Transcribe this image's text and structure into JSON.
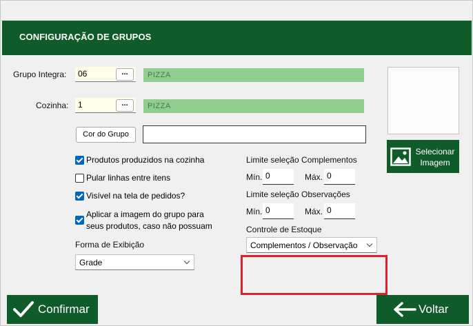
{
  "header": {
    "title": "CONFIGURAÇÃO DE GRUPOS"
  },
  "grupo_integra": {
    "label": "Grupo Integra:",
    "code": "06",
    "lookup_label": "...",
    "name": "PIZZA"
  },
  "cozinha": {
    "label": "Cozinha:",
    "code": "1",
    "lookup_label": "...",
    "name": "PIZZA"
  },
  "cor_do_grupo": {
    "button_label": "Cor do Grupo",
    "value": ""
  },
  "image": {
    "select_label_line1": "Selecionar",
    "select_label_line2": "Imagem",
    "icon": "image-icon"
  },
  "options": [
    {
      "label": "Produtos produzidos na cozinha",
      "checked": true
    },
    {
      "label": "Pular linhas entre itens",
      "checked": false
    },
    {
      "label": "Visível na tela de pedidos?",
      "checked": true
    },
    {
      "label_line1": "Aplicar a imagem do grupo para",
      "label_line2": "seus produtos, caso não possuam",
      "checked": true
    }
  ],
  "limite_complementos": {
    "title": "Limite seleção Complementos",
    "min_label": "Mín.",
    "min_value": "0",
    "max_label": "Máx.",
    "max_value": "0"
  },
  "limite_observacoes": {
    "title": "Limite seleção Observações",
    "min_label": "Mín.",
    "min_value": "0",
    "max_label": "Máx.",
    "max_value": "0"
  },
  "controle_estoque": {
    "label": "Controle de Estoque",
    "selected": "Complementos / Observação"
  },
  "forma_exibicao": {
    "label": "Forma de Exibição",
    "selected": "Grade"
  },
  "footer": {
    "confirm_label": "Confirmar",
    "back_label": "Voltar"
  },
  "colors": {
    "brand_green": "#0f5c2a",
    "field_green": "#8fce8f",
    "checkbox_blue": "#0067c0",
    "highlight_red": "#e0202a"
  }
}
